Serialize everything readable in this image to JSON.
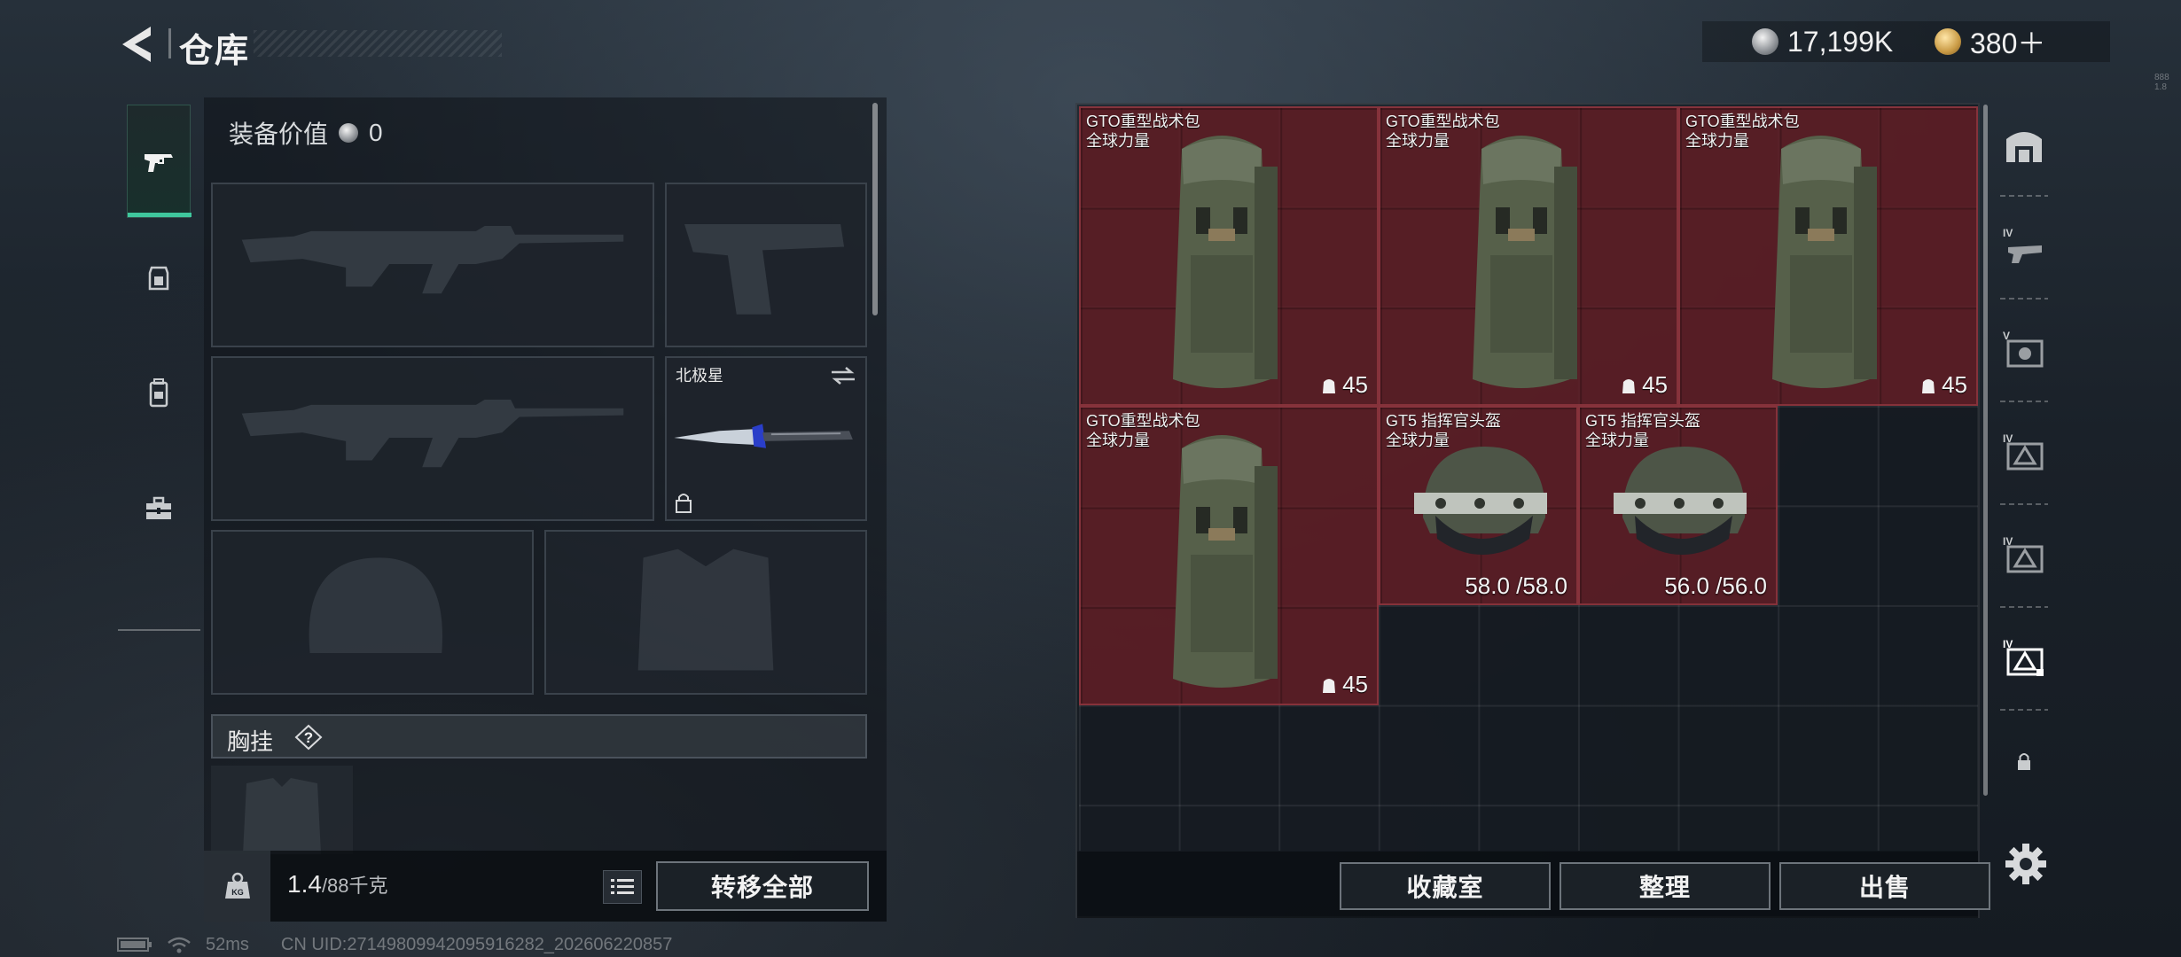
{
  "header": {
    "title": "仓库",
    "currency_primary": "17,199K",
    "currency_secondary": "380＋",
    "corner_tiny": "888 1.8"
  },
  "equipment": {
    "value_label": "装备价值",
    "value": "0",
    "melee_slot_label": "北极星",
    "chest_label": "胸挂",
    "help_symbol": "?",
    "weight_current": "1.4",
    "weight_max": "/88千克",
    "transfer_all_label": "转移全部"
  },
  "storage": {
    "items": [
      {
        "name": "GTO重型战术包",
        "sub": "全球力量",
        "capacity": "45"
      },
      {
        "name": "GTO重型战术包",
        "sub": "全球力量",
        "capacity": "45"
      },
      {
        "name": "GTO重型战术包",
        "sub": "全球力量",
        "capacity": "45"
      },
      {
        "name": "GTO重型战术包",
        "sub": "全球力量",
        "capacity": "45"
      },
      {
        "name": "GT5 指挥官头盔",
        "sub": "全球力量",
        "durability": "58.0 /58.0"
      },
      {
        "name": "GT5 指挥官头盔",
        "sub": "全球力量",
        "durability": "56.0 /56.0"
      }
    ],
    "buttons": {
      "collection": "收藏室",
      "organize": "整理",
      "sell": "出售"
    }
  },
  "right_tabs": [
    "storage-home",
    "level-IV",
    "level-V",
    "level-IV",
    "level-IV",
    "level-IV-selected",
    "locked"
  ],
  "status": {
    "ping": "52ms",
    "uid": "CN UID:27149809942095916282_202606220857"
  },
  "colors": {
    "accent_green": "#3fc79d",
    "item_red": "#64202a",
    "button_border": "#6d747b"
  }
}
